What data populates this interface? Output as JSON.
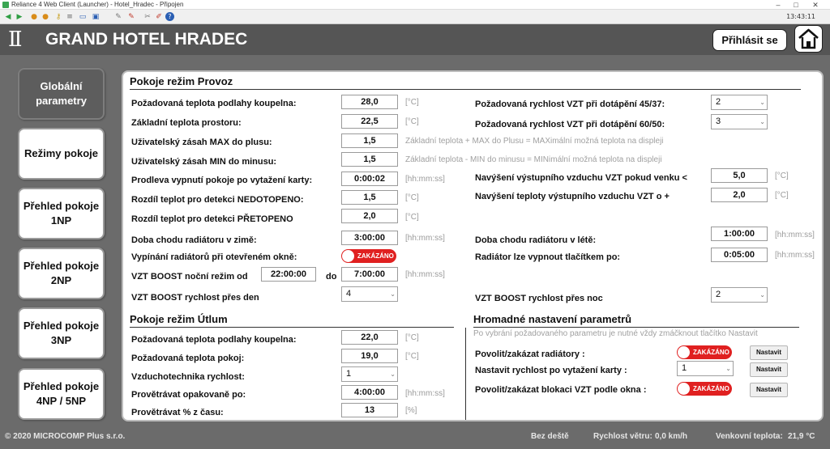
{
  "window": {
    "title": "Reliance 4 Web Client (Launcher) - Hotel_Hradec - Připojen",
    "clock": "13:43:11",
    "controls": [
      "–",
      "□",
      "✕"
    ]
  },
  "toolbar": {
    "icons": [
      "arrow-left-icon",
      "arrow-right-icon",
      "arrow-up-icon",
      "user-icon",
      "users-icon",
      "key-icon",
      "list-icon",
      "monitor-icon",
      "computer-icon",
      "edit-icon",
      "edit-red-icon",
      "help-icon"
    ]
  },
  "header": {
    "logo": "ΙΙ",
    "title": "GRAND HOTEL HRADEC",
    "login_label": "Přihlásit se"
  },
  "nav": {
    "items": [
      {
        "label": "Globální parametry",
        "active": true
      },
      {
        "label": "Režimy pokoje",
        "active": false
      },
      {
        "label": "Přehled pokoje 1NP",
        "active": false
      },
      {
        "label": "Přehled pokoje 2NP",
        "active": false
      },
      {
        "label": "Přehled pokoje 3NP",
        "active": false
      },
      {
        "label": "Přehled pokoje 4NP / 5NP",
        "active": false
      }
    ]
  },
  "provoz": {
    "title": "Pokoje režim Provoz",
    "left": [
      {
        "label": "Požadovaná teplota podlahy koupelna:",
        "value": "28,0",
        "unit": "[°C]"
      },
      {
        "label": "Základní teplota prostoru:",
        "value": "22,5",
        "unit": "[°C]"
      },
      {
        "label": "Uživatelský zásah MAX do plusu:",
        "value": "1,5",
        "unit": "Základní teplota + MAX do Plusu = MAXimální možná teplota na displeji"
      },
      {
        "label": "Uživatelský zásah MIN do minusu:",
        "value": "1,5",
        "unit": "Základní teplota - MIN do minusu = MINimální možná teplota na displeji"
      },
      {
        "label": "Prodleva vypnutí pokoje po vytažení karty:",
        "value": "0:00:02",
        "unit": "[hh:mm:ss]"
      },
      {
        "label": "Rozdíl teplot pro detekci NEDOTOPENO:",
        "value": "1,5",
        "unit": "[°C]"
      },
      {
        "label": "Rozdíl teplot pro detekci PŘETOPENO",
        "value": "2,0",
        "unit": "[°C]"
      },
      {
        "label": "Doba chodu radiátoru v zimě:",
        "value": "3:00:00",
        "unit": "[hh:mm:ss]"
      }
    ],
    "window_label": "Vypínání radiátorů při otevřeném okně:",
    "toggle_text": "ZAKÁZÁNO",
    "boost_label": "VZT BOOST noční režim od",
    "boost_from": "22:00:00",
    "boost_do": "do",
    "boost_to": "7:00:00",
    "boost_unit": "[hh:mm:ss]",
    "boost_day_label": "VZT BOOST rychlost přes den",
    "boost_day_value": "4",
    "right": {
      "speed45_label": "Požadovaná rychlost VZT při dotápění 45/37:",
      "speed45_value": "2",
      "speed60_label": "Požadovaná rychlost VZT při dotápění 60/50:",
      "speed60_value": "3",
      "outraise_label": "Navýšení výstupního vzduchu VZT pokud venku <",
      "outraise_value": "5,0",
      "outraise_unit": "[°C]",
      "tempraise_label": "Navýšení teploty výstupního vzduchu VZT o +",
      "tempraise_value": "2,0",
      "tempraise_unit": "[°C]",
      "summer_label": "Doba chodu radiátoru v létě:",
      "summer_value": "1:00:00",
      "summer_unit": "[hh:mm:ss]",
      "button_label": "Radiátor lze vypnout tlačítkem po:",
      "button_value": "0:05:00",
      "button_unit": "[hh:mm:ss]",
      "night_label": "VZT BOOST rychlost přes noc",
      "night_value": "2"
    }
  },
  "utlum": {
    "title": "Pokoje režim Útlum",
    "rows": [
      {
        "label": "Požadovaná teplota podlahy koupelna:",
        "value": "22,0",
        "unit": "[°C]"
      },
      {
        "label": "Požadovaná teplota pokoj:",
        "value": "19,0",
        "unit": "[°C]"
      },
      {
        "label": "Vzduchotechnika rychlost:",
        "value": "1",
        "unit": ""
      },
      {
        "label": "Provětrávat opakovaně po:",
        "value": "4:00:00",
        "unit": "[hh:mm:ss]"
      },
      {
        "label": "Provětrávat % z času:",
        "value": "13",
        "unit": "[%]"
      }
    ]
  },
  "hromadne": {
    "title": "Hromadné nastavení parametrů",
    "note": "Po vybrání požadovaného parametru je nutné vždy zmáčknout tlačítko Nastavit",
    "rad_label": "Povolit/zakázat radiátory :",
    "rad_toggle": "ZAKÁZÁNO",
    "speed_label": "Nastavit rychlost po vytažení karty :",
    "speed_value": "1",
    "block_label": "Povolit/zakázat blokaci VZT podle okna :",
    "block_toggle": "ZAKÁZÁNO",
    "set_label": "Nastavit"
  },
  "status": {
    "copyright": "© 2020 MICROCOMP Plus s.r.o.",
    "rain": "Bez deště",
    "wind_label": "Rychlost větru:",
    "wind_value": "0,0 km/h",
    "outside_label": "Venkovní teplota:",
    "outside_value": "21,9 °C"
  },
  "colors": {
    "header": "#555555",
    "toggle_red": "#e02020",
    "nav_active": "#5d5d5d"
  }
}
